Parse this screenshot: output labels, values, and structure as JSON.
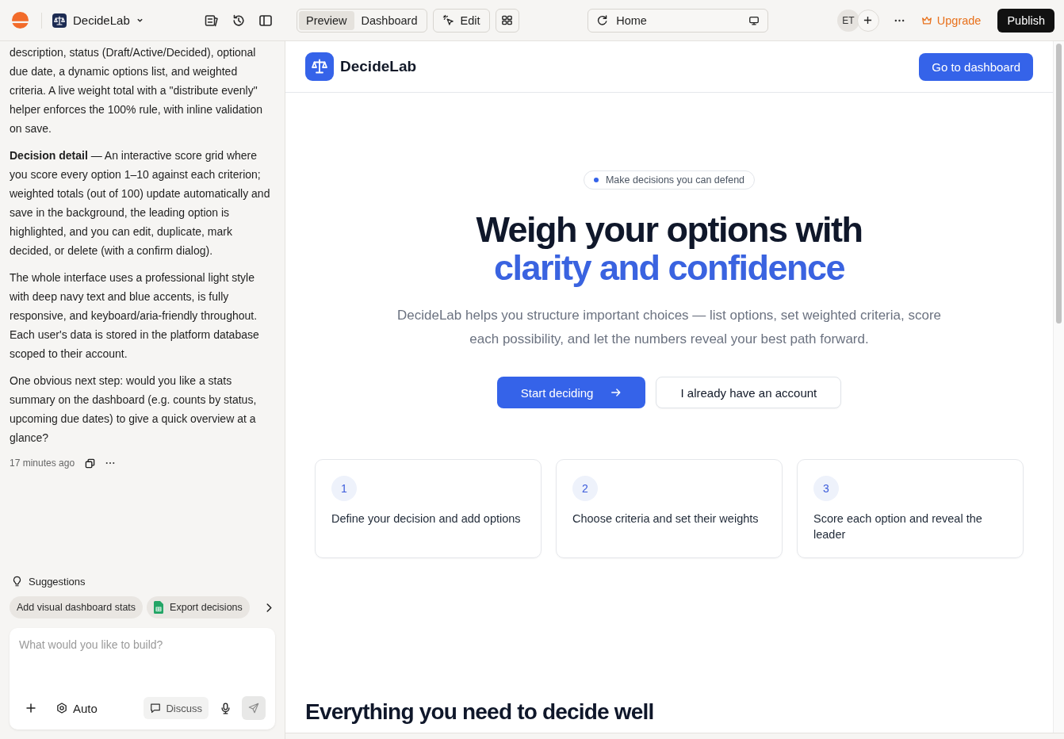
{
  "top_bar": {
    "project_name": "DecideLab",
    "view_tabs": [
      {
        "label": "Preview",
        "selected": true
      },
      {
        "label": "Dashboard",
        "selected": false
      }
    ],
    "edit_label": "Edit",
    "page": "Home",
    "avatar_initials": "ET",
    "upgrade_label": "Upgrade",
    "publish_label": "Publish"
  },
  "chat": {
    "paragraphs": [
      "description, status (Draft/Active/Decided), optional due date, a dynamic options list, and weighted criteria. A live weight total with a \"distribute evenly\" helper enforces the 100% rule, with inline validation on save.",
      "**Decision detail** — An interactive score grid where you score every option 1–10 against each criterion; weighted totals (out of 100) update automatically and save in the background, the leading option is highlighted, and you can edit, duplicate, mark decided, or delete (with a confirm dialog).",
      "The whole interface uses a professional light style with deep navy text and blue accents, is fully responsive, and keyboard/aria-friendly throughout. Each user's data is stored in the platform database scoped to their account.",
      "One obvious next step: would you like a stats summary on the dashboard (e.g. counts by status, upcoming due dates) to give a quick overview at a glance?"
    ],
    "timestamp": "17 minutes ago",
    "suggestions_title": "Suggestions",
    "suggestions": [
      {
        "label": "Add visual dashboard stats",
        "kind": "prompt"
      },
      {
        "label": "Export decisions",
        "kind": "spreadsheet"
      }
    ],
    "composer": {
      "placeholder": "What would you like to build?",
      "mode": "Auto",
      "discuss_label": "Discuss"
    }
  },
  "preview": {
    "brand": "DecideLab",
    "header_button": "Go to dashboard",
    "badge": "Make decisions you can defend",
    "headline": "Weigh your options with",
    "headline_accent": "clarity and confidence",
    "subtitle": "DecideLab helps you structure important choices — list options, set weighted criteria, score each possibility, and let the numbers reveal your best path forward.",
    "primary_button": "Start deciding",
    "secondary_button": "I already have an account",
    "steps": [
      {
        "number": "1",
        "text": "Define your decision and add options"
      },
      {
        "number": "2",
        "text": "Choose criteria and set their weights"
      },
      {
        "number": "3",
        "text": "Score each option and reveal the leader"
      }
    ],
    "section_title": "Everything you need to decide well"
  }
}
